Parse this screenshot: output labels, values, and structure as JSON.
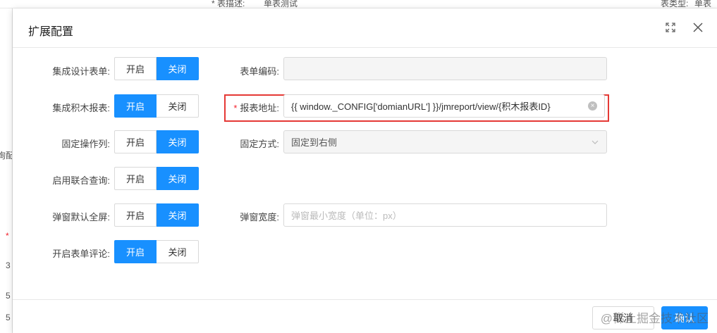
{
  "background": {
    "top_label_left": "* 表描述:",
    "top_value_left": "单表测试",
    "top_label_right": "表类型:",
    "top_value_right": "单表",
    "left_fragments": [
      "询配",
      "*",
      "3",
      "5",
      "5"
    ]
  },
  "dialog": {
    "title": "扩展配置",
    "maximize_icon": "expand-icon",
    "close_icon": "close-icon"
  },
  "toggle_labels": {
    "on": "开启",
    "off": "关闭"
  },
  "left_fields": [
    {
      "label": "集成设计表单:",
      "value": "关闭"
    },
    {
      "label": "集成积木报表:",
      "value": "开启"
    },
    {
      "label": "固定操作列:",
      "value": "关闭"
    },
    {
      "label": "启用联合查询:",
      "value": "关闭"
    },
    {
      "label": "弹窗默认全屏:",
      "value": "关闭"
    },
    {
      "label": "开启表单评论:",
      "value": "开启"
    }
  ],
  "right_fields": {
    "form_code": {
      "label": "表单编码:",
      "value": ""
    },
    "report_url": {
      "label": "报表地址:",
      "required_mark": "*",
      "value": "{{ window._CONFIG['domianURL'] }}/jmreport/view/{积木报表ID}"
    },
    "fixed_mode": {
      "label": "固定方式:",
      "value": "固定到右侧"
    },
    "popup_width": {
      "label": "弹窗宽度:",
      "placeholder": "弹窗最小宽度（单位：px）"
    }
  },
  "footer": {
    "cancel_label": "取消",
    "ok_label": "确认"
  },
  "watermark": "@稀土掘金技术社区",
  "colors": {
    "primary": "#1890ff",
    "highlight_border": "#e53935",
    "required": "#f5222d"
  }
}
